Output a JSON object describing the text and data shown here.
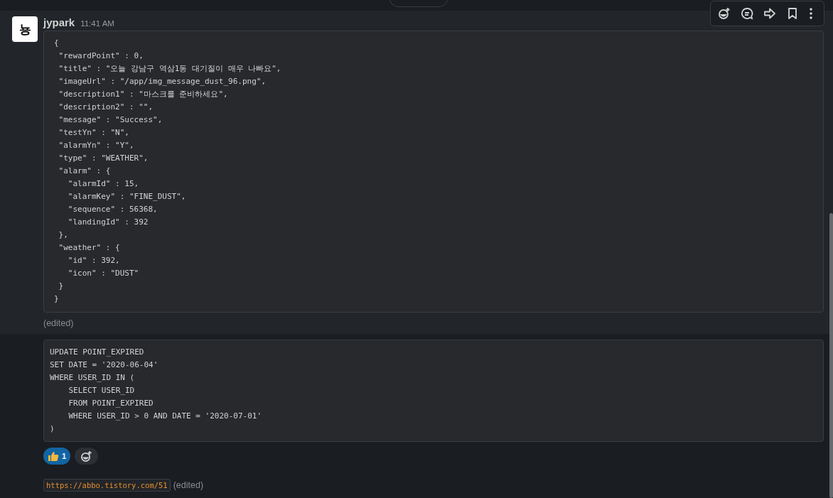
{
  "message": {
    "avatar": "뇽",
    "author": "jypark",
    "time": "11:41 AM",
    "hovered": true,
    "code_blocks": [
      {
        "code": "{\n \"rewardPoint\" : 0,\n \"title\" : \"오늘 강남구 역삼1동 대기질이 매우 나빠요\",\n \"imageUrl\" : \"/app/img_message_dust_96.png\",\n \"description1\" : \"마스크를 준비하세요\",\n \"description2\" : \"\",\n \"message\" : \"Success\",\n \"testYn\" : \"N\",\n \"alarmYn\" : \"Y\",\n \"type\" : \"WEATHER\",\n \"alarm\" : {\n   \"alarmId\" : 15,\n   \"alarmKey\" : \"FINE_DUST\",\n   \"sequence\" : 56368,\n   \"landingId\" : 392\n },\n \"weather\" : {\n   \"id\" : 392,\n   \"icon\" : \"DUST\"\n }\n}",
        "edited": "(edited)"
      }
    ]
  },
  "followups": [
    {
      "kind": "code",
      "code": "UPDATE POINT_EXPIRED\nSET DATE = '2020-06-04'\nWHERE USER_ID IN (\n    SELECT USER_ID\n    FROM POINT_EXPIRED\n    WHERE USER_ID > 0 AND DATE = '2020-07-01'\n)"
    },
    {
      "kind": "reactions",
      "reactions": [
        {
          "count": "1",
          "selected": true
        }
      ]
    },
    {
      "kind": "link",
      "url": "https://abbo.tistory.com/51",
      "edited": "(edited)"
    }
  ]
}
